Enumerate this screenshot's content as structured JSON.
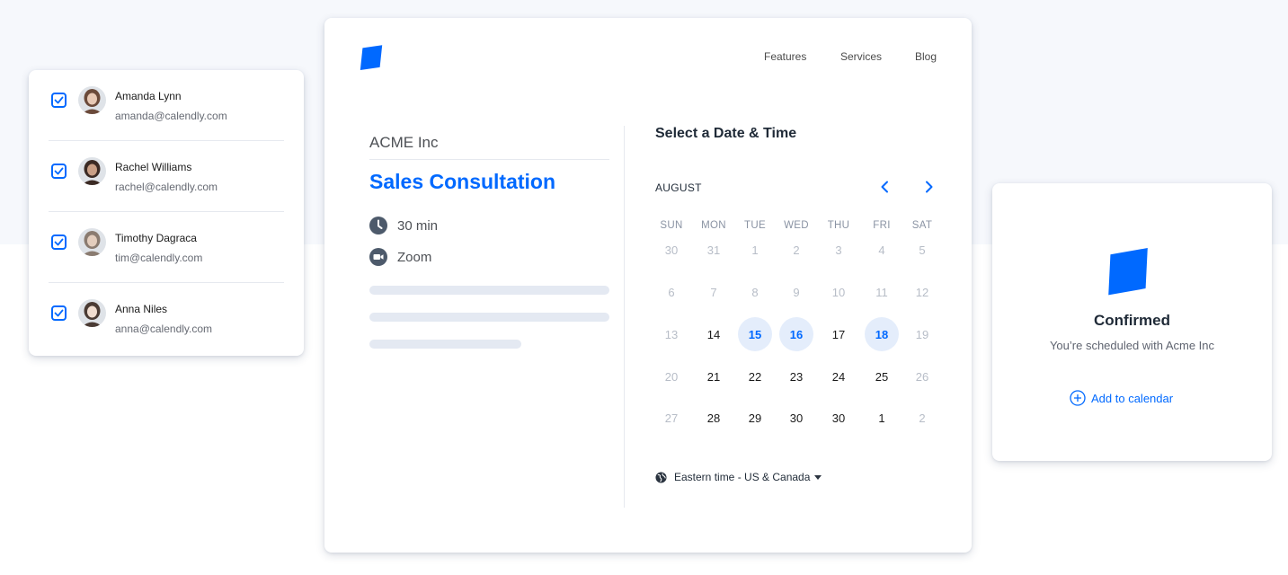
{
  "colors": {
    "accent": "#0069ff",
    "selected_bg": "#e4edfb",
    "muted": "#b7bdc7"
  },
  "team": [
    {
      "name": "Amanda Lynn",
      "email": "amanda@calendly.com",
      "checked": true
    },
    {
      "name": "Rachel Williams",
      "email": "rachel@calendly.com",
      "checked": true
    },
    {
      "name": "Timothy Dagraca",
      "email": "tim@calendly.com",
      "checked": true
    },
    {
      "name": "Anna Niles",
      "email": "anna@calendly.com",
      "checked": true
    }
  ],
  "nav": {
    "features": "Features",
    "services": "Services",
    "blog": "Blog"
  },
  "event": {
    "company": "ACME Inc",
    "title": "Sales Consultation",
    "duration": "30 min",
    "location": "Zoom",
    "duration_icon": "clock-icon",
    "location_icon": "video-camera-icon"
  },
  "calendar": {
    "heading": "Select a Date & Time",
    "month": "AUGUST",
    "weekdays": [
      "SUN",
      "MON",
      "TUE",
      "WED",
      "THU",
      "FRI",
      "SAT"
    ],
    "weeks": [
      [
        {
          "d": "30",
          "s": "muted"
        },
        {
          "d": "31",
          "s": "muted"
        },
        {
          "d": "1",
          "s": "muted"
        },
        {
          "d": "2",
          "s": "muted"
        },
        {
          "d": "3",
          "s": "muted"
        },
        {
          "d": "4",
          "s": "muted"
        },
        {
          "d": "5",
          "s": "muted"
        }
      ],
      [
        {
          "d": "6",
          "s": "muted"
        },
        {
          "d": "7",
          "s": "muted"
        },
        {
          "d": "8",
          "s": "muted"
        },
        {
          "d": "9",
          "s": "muted"
        },
        {
          "d": "10",
          "s": "muted"
        },
        {
          "d": "11",
          "s": "muted"
        },
        {
          "d": "12",
          "s": "muted"
        }
      ],
      [
        {
          "d": "13",
          "s": "muted"
        },
        {
          "d": "14",
          "s": "available"
        },
        {
          "d": "15",
          "s": "selected"
        },
        {
          "d": "16",
          "s": "selected"
        },
        {
          "d": "17",
          "s": "available"
        },
        {
          "d": "18",
          "s": "selected"
        },
        {
          "d": "19",
          "s": "muted"
        }
      ],
      [
        {
          "d": "20",
          "s": "muted"
        },
        {
          "d": "21",
          "s": "available"
        },
        {
          "d": "22",
          "s": "available"
        },
        {
          "d": "23",
          "s": "available"
        },
        {
          "d": "24",
          "s": "available"
        },
        {
          "d": "25",
          "s": "available"
        },
        {
          "d": "26",
          "s": "muted"
        }
      ],
      [
        {
          "d": "27",
          "s": "muted"
        },
        {
          "d": "28",
          "s": "available"
        },
        {
          "d": "29",
          "s": "available"
        },
        {
          "d": "30",
          "s": "available"
        },
        {
          "d": "30",
          "s": "available"
        },
        {
          "d": "1",
          "s": "available"
        },
        {
          "d": "2",
          "s": "muted"
        }
      ]
    ],
    "timezone": "Eastern time - US & Canada"
  },
  "confirmation": {
    "title": "Confirmed",
    "subtitle": "You’re scheduled with Acme Inc",
    "add_to_calendar": "Add to calendar"
  }
}
